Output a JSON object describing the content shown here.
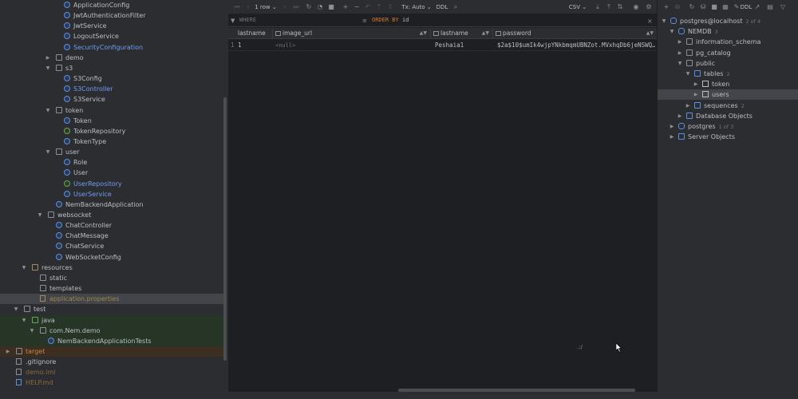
{
  "project_tree": [
    {
      "label": "ApplicationConfig",
      "kind": "cls",
      "depth": 7,
      "style": "normal"
    },
    {
      "label": "JwtAuthenticationFilter",
      "kind": "cls",
      "depth": 7,
      "style": "normal"
    },
    {
      "label": "JwtService",
      "kind": "cls",
      "depth": 7,
      "style": "normal"
    },
    {
      "label": "LogoutService",
      "kind": "cls",
      "depth": 7,
      "style": "normal"
    },
    {
      "label": "SecurityConfiguration",
      "kind": "cls",
      "depth": 7,
      "style": "blue"
    },
    {
      "label": "demo",
      "kind": "folder",
      "depth": 6,
      "arrow": "right",
      "style": "normal"
    },
    {
      "label": "s3",
      "kind": "folder",
      "depth": 6,
      "arrow": "down",
      "style": "normal"
    },
    {
      "label": "S3Config",
      "kind": "cls",
      "depth": 7,
      "style": "normal"
    },
    {
      "label": "S3Controller",
      "kind": "cls",
      "depth": 7,
      "style": "blue"
    },
    {
      "label": "S3Service",
      "kind": "cls",
      "depth": 7,
      "style": "normal"
    },
    {
      "label": "token",
      "kind": "folder",
      "depth": 6,
      "arrow": "down",
      "style": "normal"
    },
    {
      "label": "Token",
      "kind": "cls",
      "depth": 7,
      "style": "normal"
    },
    {
      "label": "TokenRepository",
      "kind": "iface",
      "depth": 7,
      "style": "normal"
    },
    {
      "label": "TokenType",
      "kind": "cls",
      "depth": 7,
      "style": "normal"
    },
    {
      "label": "user",
      "kind": "folder",
      "depth": 6,
      "arrow": "down",
      "style": "normal"
    },
    {
      "label": "Role",
      "kind": "cls",
      "depth": 7,
      "style": "normal"
    },
    {
      "label": "User",
      "kind": "cls",
      "depth": 7,
      "style": "normal"
    },
    {
      "label": "UserRepository",
      "kind": "iface",
      "depth": 7,
      "style": "blue"
    },
    {
      "label": "UserService",
      "kind": "cls",
      "depth": 7,
      "style": "blue"
    },
    {
      "label": "NemBackendApplication",
      "kind": "cls",
      "depth": 6,
      "style": "normal"
    },
    {
      "label": "websocket",
      "kind": "folder",
      "depth": 5,
      "arrow": "down",
      "style": "normal"
    },
    {
      "label": "ChatController",
      "kind": "cls",
      "depth": 6,
      "style": "normal"
    },
    {
      "label": "ChatMessage",
      "kind": "cls",
      "depth": 6,
      "style": "normal"
    },
    {
      "label": "ChatService",
      "kind": "cls",
      "depth": 6,
      "style": "normal"
    },
    {
      "label": "WebSocketConfig",
      "kind": "cls",
      "depth": 6,
      "style": "normal"
    },
    {
      "label": "resources",
      "kind": "folder-res",
      "depth": 3,
      "arrow": "down",
      "style": "normal"
    },
    {
      "label": "static",
      "kind": "folder",
      "depth": 4,
      "style": "normal"
    },
    {
      "label": "templates",
      "kind": "folder",
      "depth": 4,
      "style": "normal"
    },
    {
      "label": "application.properties",
      "kind": "file-props",
      "depth": 4,
      "style": "props",
      "row": "sel"
    },
    {
      "label": "test",
      "kind": "folder",
      "depth": 2,
      "arrow": "down",
      "style": "normal"
    },
    {
      "label": "java",
      "kind": "folder-src",
      "depth": 3,
      "arrow": "down",
      "style": "normal",
      "row": "green"
    },
    {
      "label": "com.Nem.demo",
      "kind": "folder",
      "depth": 4,
      "arrow": "down",
      "style": "normal",
      "row": "green"
    },
    {
      "label": "NemBackendApplicationTests",
      "kind": "cls",
      "depth": 5,
      "style": "normal",
      "row": "green"
    },
    {
      "label": "target",
      "kind": "folder",
      "depth": 1,
      "arrow": "right",
      "style": "orange",
      "row": "orange"
    },
    {
      "label": ".gitignore",
      "kind": "file",
      "depth": 1,
      "style": "normal"
    },
    {
      "label": "demo.iml",
      "kind": "file",
      "depth": 1,
      "style": "muted"
    },
    {
      "label": "HELP.md",
      "kind": "file-md",
      "depth": 1,
      "style": "muted"
    }
  ],
  "results_toolbar": {
    "rows_label": "1 row",
    "tx_label": "Tx: Auto",
    "ddl_label": "DDL",
    "export_format": "CSV"
  },
  "filter": {
    "where_placeholder": "WHERE",
    "order_keyword": "ORDER BY",
    "order_value": "id"
  },
  "grid": {
    "columns": [
      "lastname",
      "image_url",
      "lastname",
      "password"
    ],
    "rows": [
      {
        "row_number": "1",
        "cells": [
          "1",
          "<null>",
          "Peshaia1",
          "$2a$10$umIk4wjpYNkbmqmUBNZot.MVxhqDb6jeNSWQ…"
        ]
      }
    ]
  },
  "status_mark": ".:/",
  "db_toolbar": {
    "ddl_label": "DDL"
  },
  "db_tree": [
    {
      "label": "postgres@localhost",
      "count": "2 of 4",
      "kind": "db",
      "depth": 0,
      "arrow": "down"
    },
    {
      "label": "NEMDB",
      "count": "3",
      "kind": "db",
      "depth": 1,
      "arrow": "down"
    },
    {
      "label": "information_schema",
      "kind": "schema",
      "depth": 2,
      "arrow": "right"
    },
    {
      "label": "pg_catalog",
      "kind": "schema",
      "depth": 2,
      "arrow": "right"
    },
    {
      "label": "public",
      "kind": "schema",
      "depth": 2,
      "arrow": "down"
    },
    {
      "label": "tables",
      "count": "2",
      "kind": "pgfolder",
      "depth": 3,
      "arrow": "down"
    },
    {
      "label": "token",
      "kind": "table",
      "depth": 4,
      "arrow": "right"
    },
    {
      "label": "users",
      "kind": "table",
      "depth": 4,
      "arrow": "right",
      "selected": true
    },
    {
      "label": "sequences",
      "count": "2",
      "kind": "pgfolder",
      "depth": 3,
      "arrow": "right"
    },
    {
      "label": "Database Objects",
      "kind": "pgfolder",
      "depth": 2,
      "arrow": "right"
    },
    {
      "label": "postgres",
      "count": "1 of 3",
      "kind": "db",
      "depth": 1,
      "arrow": "right"
    },
    {
      "label": "Server Objects",
      "kind": "pgfolder",
      "depth": 1,
      "arrow": "right"
    }
  ]
}
